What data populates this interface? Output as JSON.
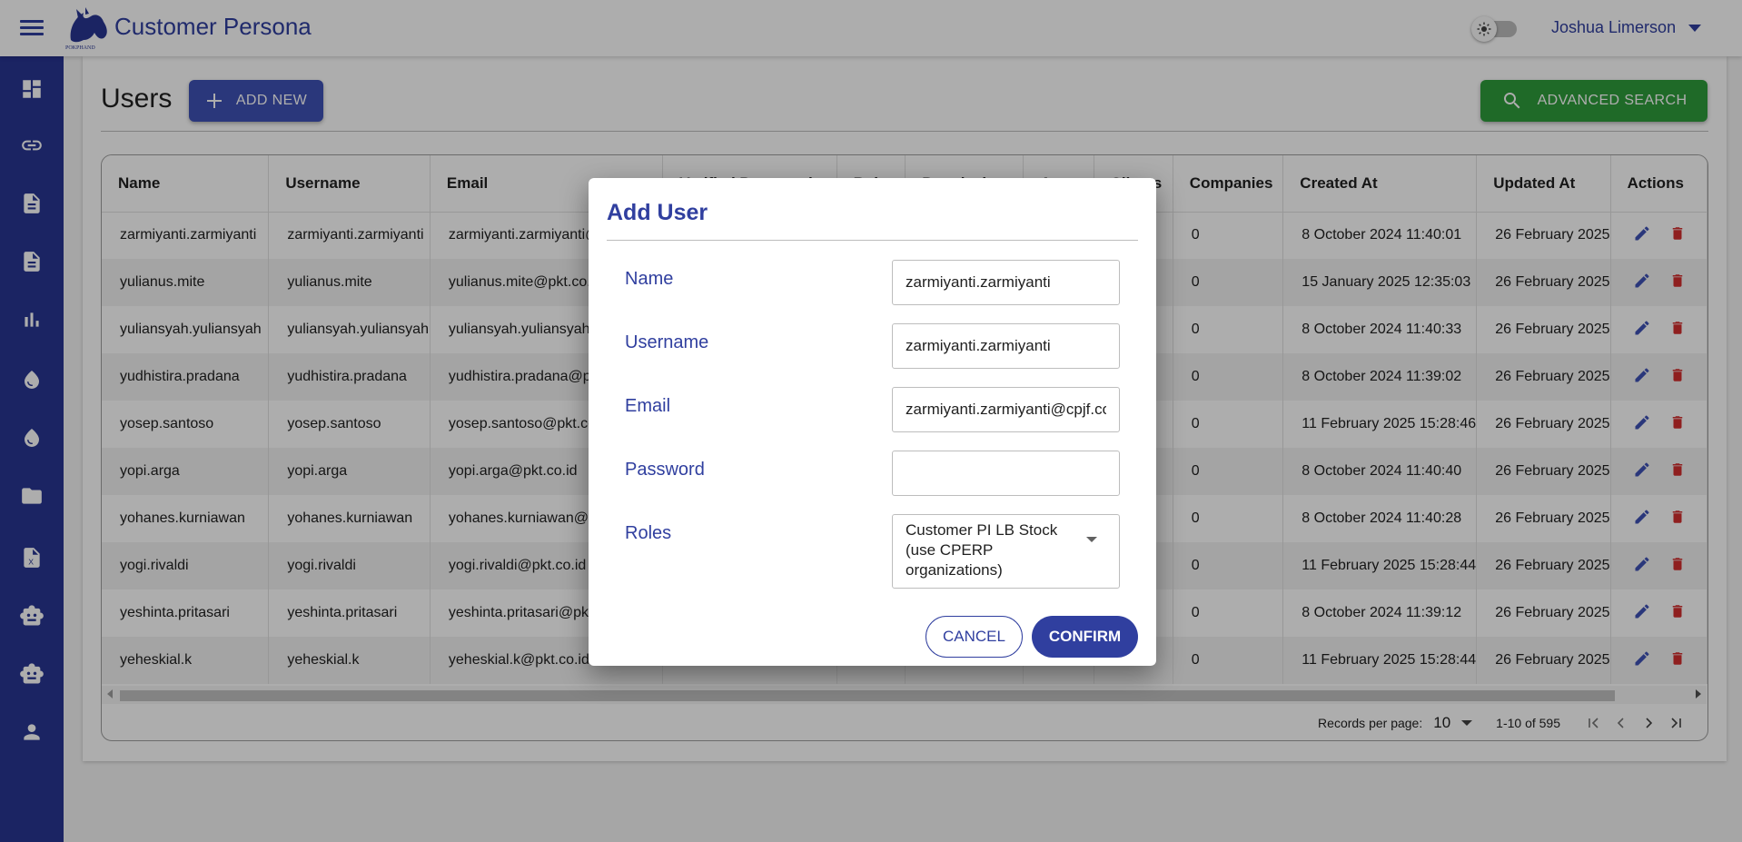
{
  "app": {
    "title": "Customer Persona",
    "logo_text": "POKPHAND"
  },
  "header": {
    "user_name": "Joshua Limerson"
  },
  "sidebar": {
    "items": [
      {
        "icon": "dashboard-icon"
      },
      {
        "icon": "link-icon"
      },
      {
        "icon": "document-icon"
      },
      {
        "icon": "document-icon"
      },
      {
        "icon": "bar-chart-icon"
      },
      {
        "icon": "drop-icon"
      },
      {
        "icon": "drop-icon"
      },
      {
        "icon": "folder-icon"
      },
      {
        "icon": "excel-file-icon"
      },
      {
        "icon": "robot-icon"
      },
      {
        "icon": "robot-icon"
      },
      {
        "icon": "person-icon"
      }
    ]
  },
  "page": {
    "title": "Users",
    "add_new_label": "ADD NEW",
    "advanced_search_label": "ADVANCED SEARCH"
  },
  "table": {
    "columns": [
      "Name",
      "Username",
      "Email",
      "Verified Password",
      "Roles",
      "Permissions",
      "Areas",
      "Clients",
      "Companies",
      "Created At",
      "Updated At",
      "Actions"
    ],
    "rows": [
      {
        "name": "zarmiyanti.zarmiyanti",
        "username": "zarmiyanti.zarmiyanti",
        "email": "zarmiyanti.zarmiyanti@cpjf.co.id",
        "companies": "0",
        "created": "8 October 2024 11:40:01",
        "updated": "26 February 2025"
      },
      {
        "name": "yulianus.mite",
        "username": "yulianus.mite",
        "email": "yulianus.mite@pkt.co.id",
        "companies": "0",
        "created": "15 January 2025 12:35:03",
        "updated": "26 February 2025"
      },
      {
        "name": "yuliansyah.yuliansyah",
        "username": "yuliansyah.yuliansyah",
        "email": "yuliansyah.yuliansyah@pkt.co.id",
        "companies": "0",
        "created": "8 October 2024 11:40:33",
        "updated": "26 February 2025"
      },
      {
        "name": "yudhistira.pradana",
        "username": "yudhistira.pradana",
        "email": "yudhistira.pradana@pkt.co.id",
        "companies": "0",
        "created": "8 October 2024 11:39:02",
        "updated": "26 February 2025"
      },
      {
        "name": "yosep.santoso",
        "username": "yosep.santoso",
        "email": "yosep.santoso@pkt.co.id",
        "companies": "0",
        "created": "11 February 2025 15:28:46",
        "updated": "26 February 2025"
      },
      {
        "name": "yopi.arga",
        "username": "yopi.arga",
        "email": "yopi.arga@pkt.co.id",
        "companies": "0",
        "created": "8 October 2024 11:40:40",
        "updated": "26 February 2025"
      },
      {
        "name": "yohanes.kurniawan",
        "username": "yohanes.kurniawan",
        "email": "yohanes.kurniawan@pkt.co.id",
        "companies": "0",
        "created": "8 October 2024 11:40:28",
        "updated": "26 February 2025"
      },
      {
        "name": "yogi.rivaldi",
        "username": "yogi.rivaldi",
        "email": "yogi.rivaldi@pkt.co.id",
        "companies": "0",
        "created": "11 February 2025 15:28:44",
        "updated": "26 February 2025"
      },
      {
        "name": "yeshinta.pritasari",
        "username": "yeshinta.pritasari",
        "email": "yeshinta.pritasari@pkt.co.id",
        "companies": "0",
        "created": "8 October 2024 11:39:12",
        "updated": "26 February 2025"
      },
      {
        "name": "yeheskial.k",
        "username": "yeheskial.k",
        "email": "yeheskial.k@pkt.co.id",
        "companies": "0",
        "created": "11 February 2025 15:28:44",
        "updated": "26 February 2025"
      }
    ]
  },
  "pagination": {
    "records_per_page_label": "Records per page:",
    "records_per_page": "10",
    "range": "1-10 of 595"
  },
  "dialog": {
    "title": "Add User",
    "fields": {
      "name": {
        "label": "Name",
        "value": "zarmiyanti.zarmiyanti"
      },
      "username": {
        "label": "Username",
        "value": "zarmiyanti.zarmiyanti"
      },
      "email": {
        "label": "Email",
        "value": "zarmiyanti.zarmiyanti@cpjf.co.id"
      },
      "password": {
        "label": "Password",
        "value": ""
      },
      "roles": {
        "label": "Roles",
        "value": "Customer PI LB Stock (use CPERP organizations)"
      }
    },
    "cancel_label": "CANCEL",
    "confirm_label": "CONFIRM"
  },
  "colors": {
    "primary": "#303f9f",
    "sidebar": "#283593",
    "success": "#2e9d3b",
    "edit_icon": "#3f51b5",
    "delete_icon": "#d32f2f"
  }
}
